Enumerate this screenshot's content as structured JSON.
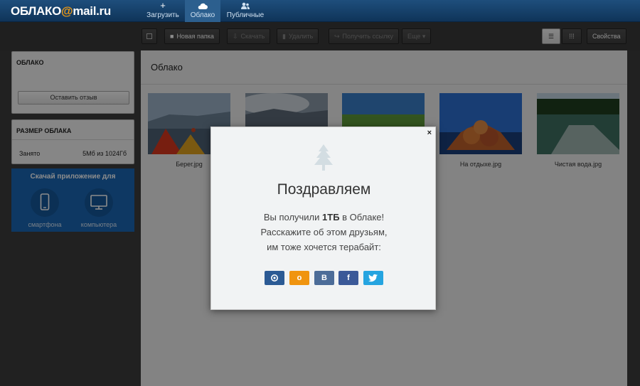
{
  "logo": {
    "part1": "ОБЛАКО",
    "at": "@",
    "part2": "mail.ru"
  },
  "nav": [
    {
      "label": "Загрузить",
      "icon": "plus-icon"
    },
    {
      "label": "Облако",
      "icon": "cloud-icon"
    },
    {
      "label": "Публичные",
      "icon": "users-icon"
    }
  ],
  "toolbar": {
    "new_folder": "Новая папка",
    "download": "Скачать",
    "delete": "Удалить",
    "get_link": "Получить ссылку",
    "more": "Еще",
    "properties": "Свойства"
  },
  "sidebar": {
    "cloud_title": "ОБЛАКО",
    "feedback": "Оставить отзыв",
    "size_title": "РАЗМЕР ОБЛАКА",
    "used_label": "Занято",
    "used_value": "5Мб из 1024Гб",
    "app_title": "Скачай приложение для",
    "app_phone": "смартфона",
    "app_pc": "компьютера"
  },
  "content": {
    "title": "Облако",
    "files": [
      {
        "name": "Берег.jpg"
      },
      {
        "name": ""
      },
      {
        "name": ""
      },
      {
        "name": "На отдыхе.jpg"
      },
      {
        "name": "Чистая вода.jpg"
      }
    ]
  },
  "modal": {
    "title": "Поздравляем",
    "line1_pre": "Вы получили ",
    "line1_bold": "1ТБ",
    "line1_post": " в Облаке!",
    "line2": "Расскажите об этом друзьям,",
    "line3": "им тоже хочется терабайт:",
    "close": "×",
    "social": [
      {
        "name": "mailru-share-icon",
        "color": "#2b5a94"
      },
      {
        "name": "odnoklassniki-share-icon",
        "glyph": "о",
        "color": "#f0940f"
      },
      {
        "name": "vkontakte-share-icon",
        "glyph": "В",
        "color": "#4c6c98"
      },
      {
        "name": "facebook-share-icon",
        "glyph": "f",
        "color": "#3b5998"
      },
      {
        "name": "twitter-share-icon",
        "color": "#25a4e0"
      }
    ]
  }
}
